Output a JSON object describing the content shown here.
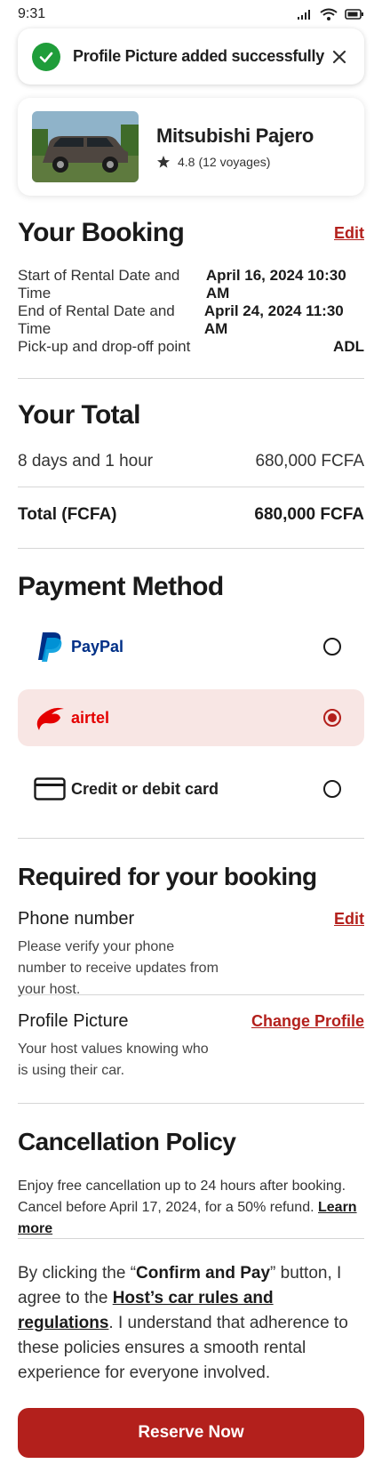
{
  "status_bar": {
    "time": "9:31"
  },
  "toast": {
    "message": "Profile Picture added successfully",
    "success_color": "#1f9d3a"
  },
  "car": {
    "name": "Mitsubishi Pajero",
    "rating": "4.8",
    "voyages": "(12 voyages)"
  },
  "booking": {
    "title": "Your Booking",
    "edit_label": "Edit",
    "rows": [
      {
        "label": "Start of Rental Date and Time",
        "value": "April 16, 2024 10:30 AM"
      },
      {
        "label": "End of Rental Date and Time",
        "value": "April 24, 2024 11:30 AM"
      },
      {
        "label": "Pick-up and drop-off point",
        "value": "ADL"
      }
    ]
  },
  "total": {
    "title": "Your Total",
    "duration_label": "8 days and 1 hour",
    "duration_value": "680,000 FCFA",
    "total_label": "Total (FCFA)",
    "total_value": "680,000 FCFA"
  },
  "payment": {
    "title": "Payment Method",
    "options": [
      {
        "label": "PayPal",
        "icon": "paypal-icon",
        "selected": false
      },
      {
        "label": "airtel",
        "icon": "airtel-icon",
        "selected": true
      },
      {
        "label": "Credit or debit card",
        "icon": "credit-card-icon",
        "selected": false
      }
    ]
  },
  "required": {
    "title": "Required for your booking",
    "phone": {
      "title": "Phone number",
      "action": "Edit",
      "desc": "Please verify your phone number to receive updates from your host."
    },
    "profile": {
      "title": "Profile Picture",
      "action": "Change Profile",
      "desc": "Your host values knowing who is using their car."
    }
  },
  "cancellation": {
    "title": "Cancellation Policy",
    "text": "Enjoy free cancellation up to 24 hours after booking. Cancel before April 17, 2024, for a 50% refund.",
    "link": "Learn more"
  },
  "agreement": {
    "prefix": "By clicking the “",
    "button_ref": "Confirm and Pay",
    "mid": "” button, I agree to the ",
    "rules_link": "Host’s car rules and regulations",
    "suffix": ". I understand that adherence to these policies ensures a smooth rental experience for everyone involved."
  },
  "cta": {
    "label": "Reserve Now"
  },
  "colors": {
    "accent": "#b3201c",
    "selected_bg": "#f8e6e4",
    "paypal_dark": "#003087",
    "paypal_light": "#009cde",
    "airtel": "#e40000"
  }
}
